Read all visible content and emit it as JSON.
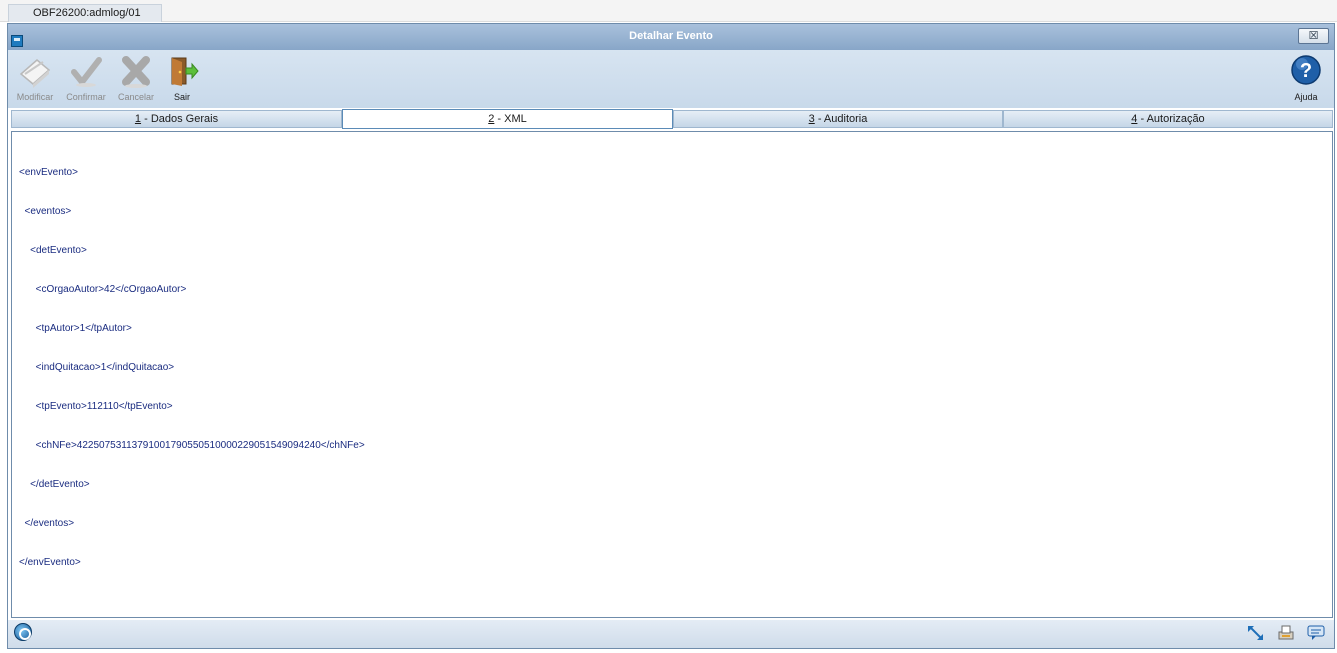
{
  "app_tab": {
    "label": "OBF26200:admlog/01"
  },
  "window": {
    "title": "Detalhar Evento",
    "close_symbol": "☒"
  },
  "toolbar": {
    "modify": {
      "label": "Modificar",
      "icon": "edit-paper-icon",
      "enabled": false
    },
    "confirm": {
      "label": "Confirmar",
      "icon": "checkmark-icon",
      "enabled": false
    },
    "cancel": {
      "label": "Cancelar",
      "icon": "x-cross-icon",
      "enabled": false
    },
    "exit": {
      "label": "Sair",
      "icon": "exit-door-icon",
      "enabled": true
    },
    "help": {
      "label": "Ajuda",
      "icon": "question-help-icon",
      "symbol": "?"
    }
  },
  "tabs": [
    {
      "key": "1",
      "label": " - Dados Gerais",
      "active": false
    },
    {
      "key": "2",
      "label": " - XML",
      "active": true
    },
    {
      "key": "3",
      "label": " - Auditoria",
      "active": false
    },
    {
      "key": "4",
      "label": " - Autorização",
      "active": false
    }
  ],
  "xml_lines": [
    "<envEvento>",
    "  <eventos>",
    "    <detEvento>",
    "      <cOrgaoAutor>42</cOrgaoAutor>",
    "      <tpAutor>1</tpAutor>",
    "      <indQuitacao>1</indQuitacao>",
    "      <tpEvento>112110</tpEvento>",
    "      <chNFe>42250753113791001790550510000229051549094240</chNFe>",
    "    </detEvento>",
    "  </eventos>",
    "</envEvento>"
  ],
  "statusbar": {
    "icons": [
      "globe-icon",
      "resize-arrow-icon",
      "printer-icon",
      "chat-message-icon"
    ]
  },
  "colors": {
    "xml_text": "#1a2c80",
    "titlebar": "#88a6c8",
    "help_blue": "#1f5fa8"
  }
}
